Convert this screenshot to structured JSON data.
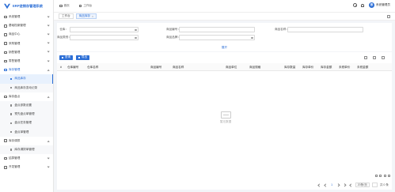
{
  "app": {
    "title": "ERP进销存管理系统",
    "brand_color": "#2d6fd6"
  },
  "sidebar": {
    "items": [
      {
        "label": "系统管理",
        "icon": "settings-icon",
        "expanded": false
      },
      {
        "label": "基础档案管理",
        "icon": "archive-icon",
        "expanded": false
      },
      {
        "label": "商品中心",
        "icon": "goods-icon",
        "expanded": false
      },
      {
        "label": "采购管理",
        "icon": "purchase-icon",
        "expanded": false
      },
      {
        "label": "销售管理",
        "icon": "sales-icon",
        "expanded": false
      },
      {
        "label": "零售管理",
        "icon": "retail-icon",
        "expanded": false
      },
      {
        "label": "库存管理",
        "icon": "inventory-icon",
        "expanded": true,
        "children": [
          {
            "label": "商品库存",
            "active": true
          },
          {
            "label": "商品库存变动记录"
          }
        ]
      },
      {
        "label": "库存盘点",
        "icon": "stocktake-icon",
        "expanded": true,
        "children": [
          {
            "label": "盘点参数设置"
          },
          {
            "label": "预先盘点单管理"
          },
          {
            "label": "盘点任务管理"
          },
          {
            "label": "盘点单管理"
          }
        ]
      },
      {
        "label": "库存调拨",
        "icon": "transfer-icon",
        "expanded": true,
        "children": [
          {
            "label": "库存调拨单管理"
          }
        ]
      },
      {
        "label": "结算管理",
        "icon": "settlement-icon",
        "expanded": false
      },
      {
        "label": "开发管理",
        "icon": "dev-icon",
        "expanded": false
      }
    ]
  },
  "topbar": {
    "crumbs": [
      {
        "label": "首页"
      },
      {
        "label": "工作台"
      }
    ],
    "user": {
      "avatar_text": "系",
      "name": "系统管理员"
    }
  },
  "tabs": [
    {
      "label": "工作台",
      "closable": false
    },
    {
      "label": "商品库存",
      "closable": true,
      "active": true
    }
  ],
  "filters": {
    "rows": [
      [
        {
          "label": "仓库：",
          "placeholder": "",
          "has_search": true
        },
        {
          "label": "商品编号：",
          "placeholder": ""
        },
        {
          "label": "商品名称：",
          "placeholder": ""
        }
      ],
      [
        {
          "label": "商品类别：",
          "placeholder": "",
          "has_search": true
        },
        {
          "label": "商品品牌：",
          "placeholder": "",
          "has_search": true
        }
      ]
    ],
    "expand_label": "展开"
  },
  "toolbar": {
    "query_label": "查询",
    "export_label": "导出"
  },
  "table": {
    "columns": [
      "#",
      "仓库编号",
      "仓库名称",
      "商品编号",
      "商品名称",
      "商品单位",
      "商品规格",
      "库存数量",
      "库存单价",
      "库存金额",
      "未税单价",
      "未税金额"
    ],
    "rows": [],
    "empty_text": "暂无数据"
  },
  "pagination": {
    "current_page": "1",
    "page_size_label": "20条/页",
    "total_label": "共 0 条"
  }
}
